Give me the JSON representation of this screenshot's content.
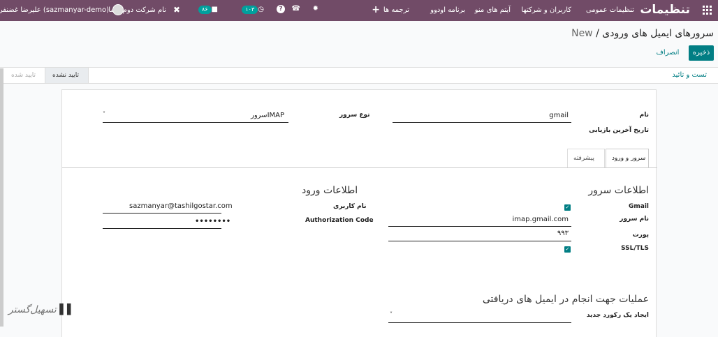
{
  "topbar": {
    "brand": "تنظیمات",
    "menu": [
      "تنظیمات عمومی",
      "کاربران و شرکتها",
      "آیتم های منو",
      "برنامه اودوو",
      "ترجمه ها"
    ],
    "plus": "+",
    "badge_activity": "۱۰۳",
    "badge_messages": "۸۶",
    "company": "نام شرکت دوم شما",
    "user": "علیرضا غضنفری (sazmanyar-demo)"
  },
  "breadcrumb": {
    "parent": "سرورهای ایمیل های ورودی",
    "separator": "/",
    "current": "New"
  },
  "buttons": {
    "save": "ذخیره",
    "discard": "انصراف"
  },
  "statusbar": {
    "test": "تست و تائید",
    "stage_active": "تایید نشده",
    "stage_inactive": "تایید شده"
  },
  "form": {
    "name_label": "نام",
    "name_value": "gmail",
    "server_type_label": "نوع سرور",
    "server_type_value": "سرورIMAP",
    "last_fetch_label": "تاریخ آخرین بازیابی",
    "tabs": [
      "سرور و ورود",
      "پیشرفته"
    ],
    "server_info_title": "اطلاعات سرور",
    "gmail_label": "Gmail",
    "server_name_label": "نام سرور",
    "server_name_value": "imap.gmail.com",
    "port_label": "پورت",
    "port_value": "۹۹۳",
    "ssl_label": "SSL/TLS",
    "login_title": "اطلاعات ورود",
    "username_label": "نام کاربری",
    "username_value": "sazmanyar@tashilgostar.com",
    "auth_label": "Authorization Code",
    "auth_value": "••••••••",
    "actions_title": "عملیات جهت انجام در ایمیل های دریافتی",
    "create_record_label": "ایجاد یک رکورد جدید"
  },
  "watermark": "تسهیل‌گستر",
  "colors": {
    "topbar": "#714b67",
    "accent": "#017e84"
  }
}
